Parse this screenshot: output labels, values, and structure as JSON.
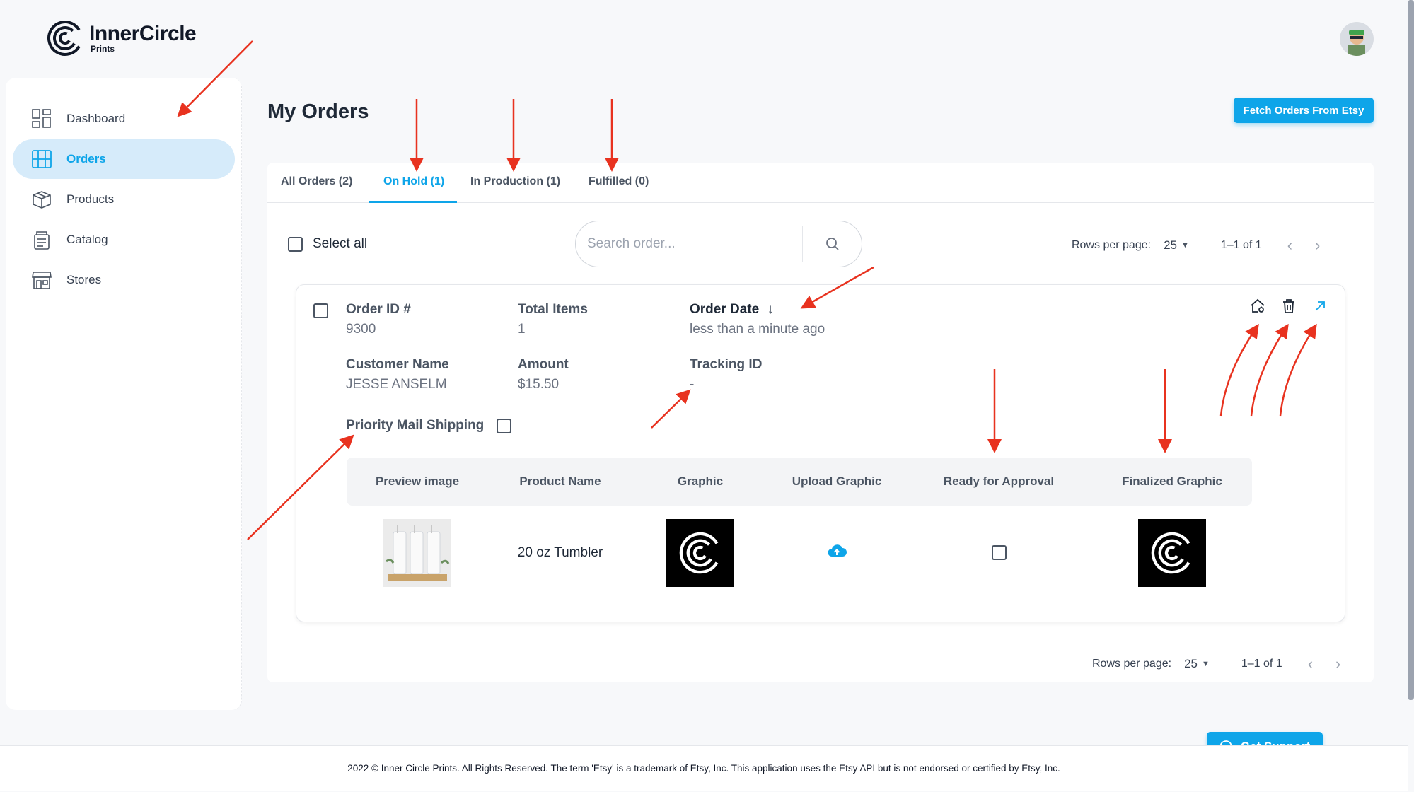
{
  "brand": {
    "title": "InnerCircle",
    "subtitle": "Prints"
  },
  "sidebar": {
    "items": [
      {
        "label": "Dashboard",
        "icon": "dashboard-icon",
        "active": false
      },
      {
        "label": "Orders",
        "icon": "orders-icon",
        "active": true
      },
      {
        "label": "Products",
        "icon": "box-icon",
        "active": false
      },
      {
        "label": "Catalog",
        "icon": "catalog-icon",
        "active": false
      },
      {
        "label": "Stores",
        "icon": "store-icon",
        "active": false
      }
    ]
  },
  "page": {
    "title": "My Orders",
    "fetch_button": "Fetch Orders From Etsy"
  },
  "tabs": [
    {
      "label": "All Orders (2)",
      "active": false
    },
    {
      "label": "On Hold (1)",
      "active": true
    },
    {
      "label": "In Production (1)",
      "active": false
    },
    {
      "label": "Fulfilled (0)",
      "active": false
    }
  ],
  "toolbar": {
    "select_all": "Select all",
    "search_placeholder": "Search order...",
    "rows_per_page_label": "Rows per page:",
    "rows_per_page_value": "25",
    "range": "1–1 of 1"
  },
  "order": {
    "order_id_label": "Order ID #",
    "order_id": "9300",
    "total_items_label": "Total Items",
    "total_items": "1",
    "order_date_label": "Order Date",
    "order_date": "less than a minute ago",
    "customer_name_label": "Customer Name",
    "customer_name": "JESSE ANSELM",
    "amount_label": "Amount",
    "amount": "$15.50",
    "tracking_label": "Tracking ID",
    "tracking": "-",
    "priority_label": "Priority Mail Shipping",
    "actions": [
      "home-icon",
      "trash-icon",
      "external-link-icon"
    ]
  },
  "items_table": {
    "headers": [
      "Preview image",
      "Product Name",
      "Graphic",
      "Upload Graphic",
      "Ready for Approval",
      "Finalized Graphic"
    ],
    "rows": [
      {
        "product_name": "20 oz Tumbler",
        "ready": false
      }
    ]
  },
  "bottom_pager": {
    "rows_per_page_label": "Rows per page:",
    "rows_per_page_value": "25",
    "range": "1–1 of 1"
  },
  "footer": {
    "text": "2022 © Inner Circle Prints. All Rights Reserved. The term 'Etsy' is a trademark of Etsy, Inc. This application uses the Etsy API but is not endorsed or certified by Etsy, Inc."
  },
  "support_button": "Get Support",
  "colors": {
    "accent": "#0ea5e9",
    "active_bg": "#d6ebfa",
    "annotation": "#e8321f"
  }
}
